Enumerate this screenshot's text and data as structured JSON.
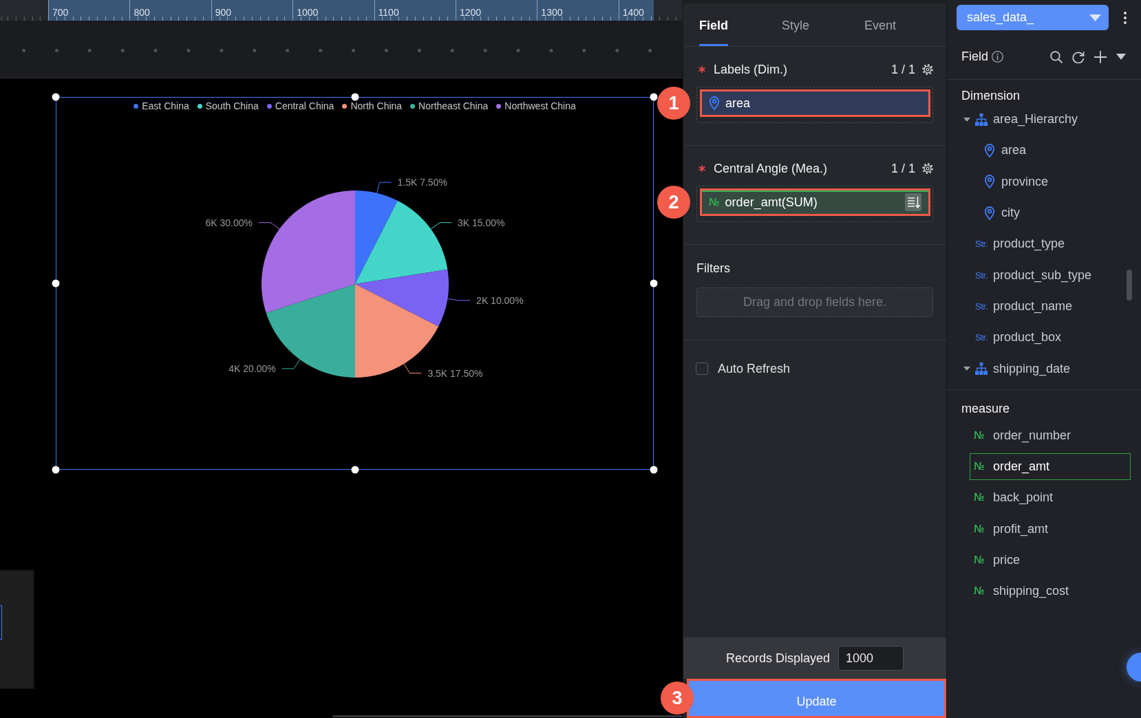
{
  "ruler": {
    "labels": [
      "700",
      "800",
      "900",
      "1000",
      "1100",
      "1200",
      "1300",
      "1400"
    ]
  },
  "canvas": {
    "chart": {
      "selected": true,
      "chart_data": {
        "type": "pie",
        "legend": "top",
        "categories": [
          "East China",
          "South China",
          "Central China",
          "North China",
          "Northeast China",
          "Northwest China"
        ],
        "values": [
          1500,
          3000,
          2000,
          3500,
          4000,
          6000
        ],
        "value_labels": [
          "1.5K 7.50%",
          "3K 15.00%",
          "2K 10.00%",
          "3.5K 17.50%",
          "4K 20.00%",
          "6K 30.00%"
        ],
        "colors": [
          "#3d72fb",
          "#44d5c9",
          "#7a62f2",
          "#f4927a",
          "#3aae9c",
          "#a46de4"
        ]
      }
    }
  },
  "config_panel": {
    "tabs": [
      {
        "label": "Field",
        "selected": true
      },
      {
        "label": "Style",
        "selected": false
      },
      {
        "label": "Event",
        "selected": false
      }
    ],
    "sections": [
      {
        "kind": "slot",
        "required": true,
        "title": "Labels (Dim.)",
        "count": "1 / 1",
        "field": {
          "kind": "dimension",
          "name": "area",
          "highlighted": true,
          "callout": "1"
        }
      },
      {
        "kind": "slot",
        "required": true,
        "title": "Central Angle (Mea.)",
        "count": "1 / 1",
        "field": {
          "kind": "measure",
          "badge": "№",
          "name": "order_amt(SUM)",
          "highlighted": true,
          "callout": "2"
        }
      },
      {
        "kind": "dropzone",
        "title": "Filters",
        "placeholder": "Drag and drop fields here."
      },
      {
        "kind": "checkbox",
        "label": "Auto Refresh",
        "checked": false
      }
    ],
    "records": {
      "label": "Records Displayed",
      "value": "1000"
    },
    "update_button": {
      "label": "Update",
      "highlighted": true,
      "callout": "3"
    }
  },
  "data_panel": {
    "dataset": {
      "label": "sales_data_"
    },
    "header": {
      "title": "Field"
    },
    "dimension_section": {
      "title": "Dimension",
      "items": [
        {
          "kind": "hierarchy",
          "name": "area_Hierarchy",
          "expanded": true,
          "selected": false,
          "children": [
            {
              "kind": "geo",
              "name": "area",
              "selected": false
            },
            {
              "kind": "geo",
              "name": "province",
              "selected": false
            },
            {
              "kind": "geo",
              "name": "city",
              "selected": false
            }
          ]
        },
        {
          "kind": "string",
          "badge": "Str.",
          "name": "product_type",
          "selected": false
        },
        {
          "kind": "string",
          "badge": "Str.",
          "name": "product_sub_type",
          "selected": false
        },
        {
          "kind": "string",
          "badge": "Str.",
          "name": "product_name",
          "selected": false
        },
        {
          "kind": "string",
          "badge": "Str.",
          "name": "product_box",
          "selected": false
        },
        {
          "kind": "hierarchy",
          "name": "shipping_date",
          "expanded": true,
          "selected": false
        }
      ]
    },
    "measure_section": {
      "title": "measure",
      "items": [
        {
          "kind": "number",
          "badge": "№",
          "name": "order_number",
          "selected": false
        },
        {
          "kind": "number",
          "badge": "№",
          "name": "order_amt",
          "selected": true
        },
        {
          "kind": "number",
          "badge": "№",
          "name": "back_point",
          "selected": false
        },
        {
          "kind": "number",
          "badge": "№",
          "name": "profit_amt",
          "selected": false
        },
        {
          "kind": "number",
          "badge": "№",
          "name": "price",
          "selected": false
        },
        {
          "kind": "number",
          "badge": "№",
          "name": "shipping_cost",
          "selected": false
        }
      ]
    }
  }
}
